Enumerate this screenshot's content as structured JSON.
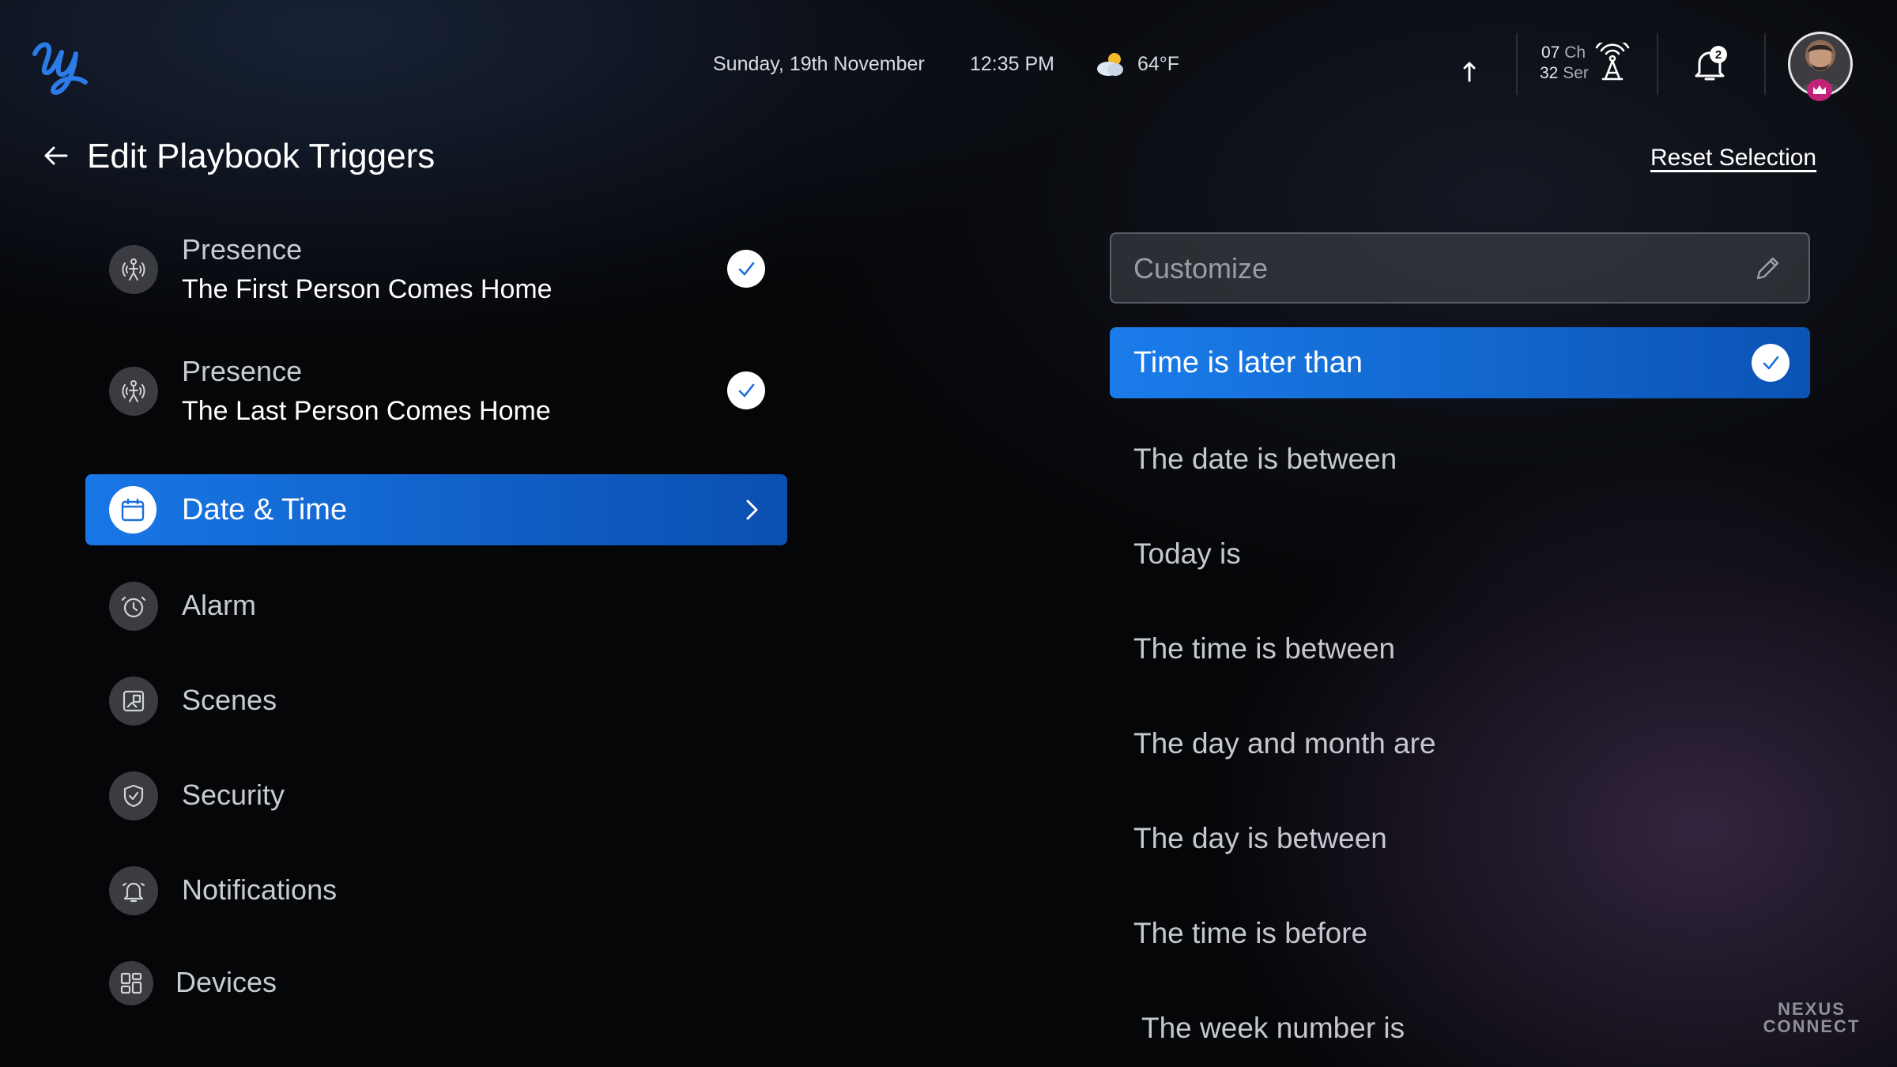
{
  "header": {
    "date": "Sunday, 19th November",
    "time": "12:35 PM",
    "temperature": "64°F",
    "channel_line1_num": "07",
    "channel_line1_unit": "Ch",
    "channel_line2_num": "32",
    "channel_line2_unit": "Ser",
    "notification_count": "2"
  },
  "page": {
    "title": "Edit Playbook Triggers",
    "reset_label": "Reset Selection"
  },
  "left_list": {
    "presence_first": {
      "label": "Presence",
      "sub": "The First Person Comes Home",
      "checked": true
    },
    "presence_last": {
      "label": "Presence",
      "sub": "The Last Person Comes Home",
      "checked": true
    },
    "date_time": {
      "label": "Date & Time",
      "selected": true
    },
    "alarm": {
      "label": "Alarm"
    },
    "scenes": {
      "label": "Scenes"
    },
    "security": {
      "label": "Security"
    },
    "notifications": {
      "label": "Notifications"
    },
    "devices": {
      "label": "Devices"
    }
  },
  "right_panel": {
    "customize_placeholder": "Customize",
    "options": [
      {
        "label": "Time is later than",
        "selected": true
      },
      {
        "label": "The date is between"
      },
      {
        "label": "Today is"
      },
      {
        "label": "The time is between"
      },
      {
        "label": "The day and month are"
      },
      {
        "label": "The day is between"
      },
      {
        "label": "The time is before"
      },
      {
        "label": "The week number is"
      }
    ]
  },
  "brand": {
    "watermark_line1": "NEXUS",
    "watermark_line2": "CONNECT"
  },
  "colors": {
    "accent": "#1877e6",
    "accent_dark": "#0b4fb0",
    "icon_bg": "#3a3c42"
  }
}
